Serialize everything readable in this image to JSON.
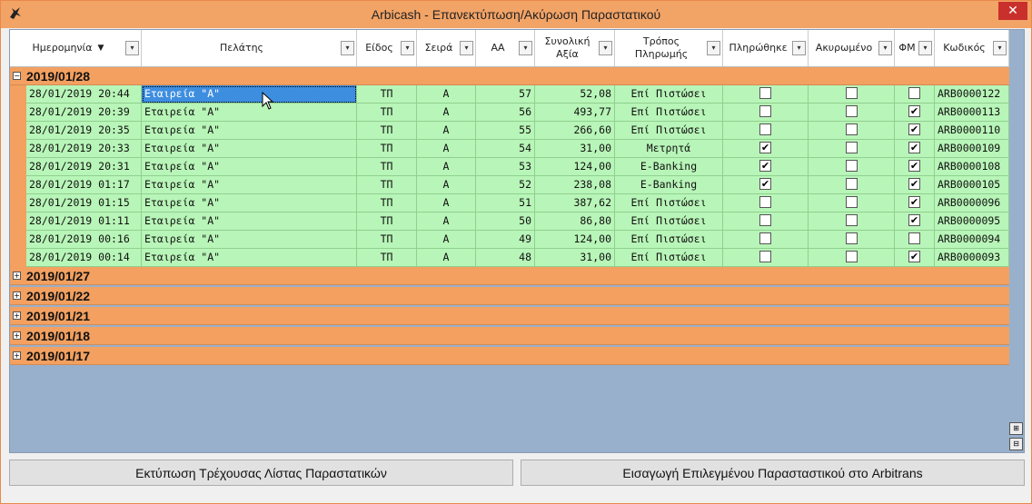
{
  "window": {
    "title": "Arbicash - Επανεκτύπωση/Ακύρωση Παραστατικού",
    "close": "✕",
    "icon": "bird-logo-icon"
  },
  "columns": [
    {
      "label": "Ημερομηνία",
      "filter": "▾"
    },
    {
      "label": "Πελάτης",
      "filter": "▾"
    },
    {
      "label": "Είδος",
      "filter": "▾"
    },
    {
      "label": "Σειρά",
      "filter": "▾"
    },
    {
      "label": "ΑΑ",
      "filter": "▾"
    },
    {
      "label": "Συνολική Αξία",
      "filter": "▾"
    },
    {
      "label": "Τρόπος Πληρωμής",
      "filter": "▾"
    },
    {
      "label": "Πληρώθηκε",
      "filter": "▾"
    },
    {
      "label": "Ακυρωμένο",
      "filter": "▾"
    },
    {
      "label": "ΦΜ",
      "filter": "▾"
    },
    {
      "label": "Κωδικός",
      "filter": "▾"
    }
  ],
  "sort_indicator": "▼",
  "groups": [
    {
      "label": "2019/01/28",
      "toggle": "−",
      "expanded": true
    },
    {
      "label": "2019/01/27",
      "toggle": "+"
    },
    {
      "label": "2019/01/22",
      "toggle": "+"
    },
    {
      "label": "2019/01/21",
      "toggle": "+"
    },
    {
      "label": "2019/01/18",
      "toggle": "+"
    },
    {
      "label": "2019/01/17",
      "toggle": "+"
    }
  ],
  "rows": [
    {
      "date": "28/01/2019 20:44",
      "customer": "Εταιρεία \"Α\"",
      "type": "ΤΠ",
      "series": "Α",
      "aa": "57",
      "total": "52,08",
      "payment": "Επί Πιστώσει",
      "paid": "",
      "cancelled": "",
      "fm": "",
      "code": "ARB0000122"
    },
    {
      "date": "28/01/2019 20:39",
      "customer": "Εταιρεία \"Α\"",
      "type": "ΤΠ",
      "series": "Α",
      "aa": "56",
      "total": "493,77",
      "payment": "Επί Πιστώσει",
      "paid": "",
      "cancelled": "",
      "fm": "✔",
      "code": "ARB0000113"
    },
    {
      "date": "28/01/2019 20:35",
      "customer": "Εταιρεία \"Α\"",
      "type": "ΤΠ",
      "series": "Α",
      "aa": "55",
      "total": "266,60",
      "payment": "Επί Πιστώσει",
      "paid": "",
      "cancelled": "",
      "fm": "✔",
      "code": "ARB0000110"
    },
    {
      "date": "28/01/2019 20:33",
      "customer": "Εταιρεία \"Α\"",
      "type": "ΤΠ",
      "series": "Α",
      "aa": "54",
      "total": "31,00",
      "payment": "Μετρητά",
      "paid": "✔",
      "cancelled": "",
      "fm": "✔",
      "code": "ARB0000109"
    },
    {
      "date": "28/01/2019 20:31",
      "customer": "Εταιρεία \"Α\"",
      "type": "ΤΠ",
      "series": "Α",
      "aa": "53",
      "total": "124,00",
      "payment": "E-Banking",
      "paid": "✔",
      "cancelled": "",
      "fm": "✔",
      "code": "ARB0000108"
    },
    {
      "date": "28/01/2019 01:17",
      "customer": "Εταιρεία \"Α\"",
      "type": "ΤΠ",
      "series": "Α",
      "aa": "52",
      "total": "238,08",
      "payment": "E-Banking",
      "paid": "✔",
      "cancelled": "",
      "fm": "✔",
      "code": "ARB0000105"
    },
    {
      "date": "28/01/2019 01:15",
      "customer": "Εταιρεία \"Α\"",
      "type": "ΤΠ",
      "series": "Α",
      "aa": "51",
      "total": "387,62",
      "payment": "Επί Πιστώσει",
      "paid": "",
      "cancelled": "",
      "fm": "✔",
      "code": "ARB0000096"
    },
    {
      "date": "28/01/2019 01:11",
      "customer": "Εταιρεία \"Α\"",
      "type": "ΤΠ",
      "series": "Α",
      "aa": "50",
      "total": "86,80",
      "payment": "Επί Πιστώσει",
      "paid": "",
      "cancelled": "",
      "fm": "✔",
      "code": "ARB0000095"
    },
    {
      "date": "28/01/2019 00:16",
      "customer": "Εταιρεία \"Α\"",
      "type": "ΤΠ",
      "series": "Α",
      "aa": "49",
      "total": "124,00",
      "payment": "Επί Πιστώσει",
      "paid": "",
      "cancelled": "",
      "fm": "",
      "code": "ARB0000094"
    },
    {
      "date": "28/01/2019 00:14",
      "customer": "Εταιρεία \"Α\"",
      "type": "ΤΠ",
      "series": "Α",
      "aa": "48",
      "total": "31,00",
      "payment": "Επί Πιστώσει",
      "paid": "",
      "cancelled": "",
      "fm": "✔",
      "code": "ARB0000093"
    }
  ],
  "scroll": {
    "expand_icon": "⊞",
    "collapse_icon": "⊟"
  },
  "buttons": {
    "print": "Εκτύπωση Τρέχουσας Λίστας Παραστατικών",
    "import": "Εισαγωγή Επιλεγμένου Παρασταστικού στο Arbitrans"
  }
}
